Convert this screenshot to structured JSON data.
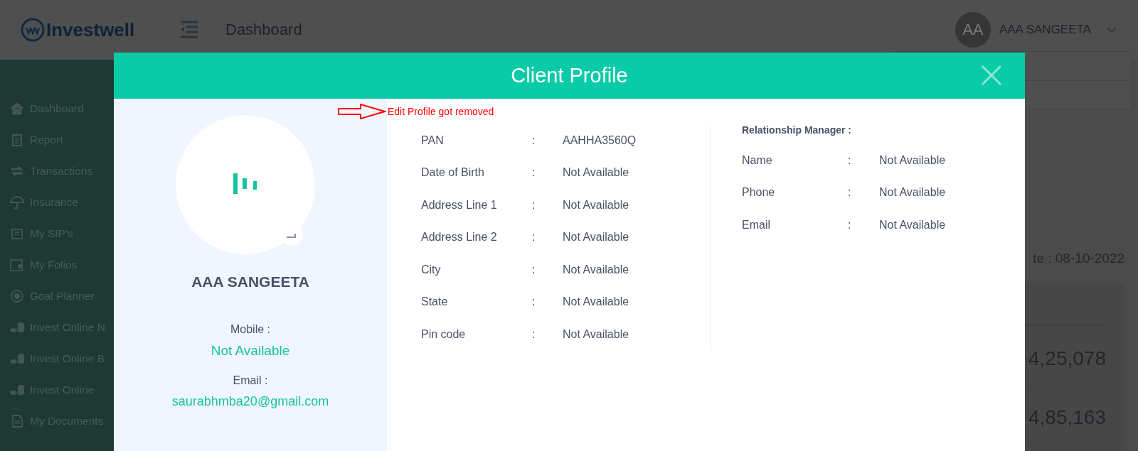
{
  "header": {
    "logo": "Investwell",
    "title": "Dashboard",
    "user": {
      "initials": "AA",
      "name": "AAA SANGEETA"
    }
  },
  "sidebar": {
    "items": [
      {
        "label": "Dashboard"
      },
      {
        "label": "Report"
      },
      {
        "label": "Transactions"
      },
      {
        "label": "Insurance"
      },
      {
        "label": "My SIP's"
      },
      {
        "label": "My Folios"
      },
      {
        "label": "Goal Planner"
      },
      {
        "label": "Invest Online N"
      },
      {
        "label": "Invest Online B"
      },
      {
        "label": "Invest Online"
      },
      {
        "label": "My Documents"
      }
    ]
  },
  "background": {
    "date_text": "te : 08-10-2022",
    "amounts": [
      "4,25,078",
      "4,85,163"
    ]
  },
  "modal": {
    "title": "Client Profile",
    "profile": {
      "name": "AAA SANGEETA",
      "mobile_label": "Mobile :",
      "mobile": "Not Available",
      "email_label": "Email :",
      "email": "saurabhmba20@gmail.com"
    },
    "details": [
      {
        "label": "PAN",
        "separator": ":",
        "value": "AAHHA3560Q"
      },
      {
        "label": "Date of Birth",
        "separator": ":",
        "value": "Not Available"
      },
      {
        "label": "Address Line 1",
        "separator": ":",
        "value": "Not Available"
      },
      {
        "label": "Address Line 2",
        "separator": ":",
        "value": "Not Available"
      },
      {
        "label": "City",
        "separator": ":",
        "value": "Not Available"
      },
      {
        "label": "State",
        "separator": ":",
        "value": "Not Available"
      },
      {
        "label": "Pin code",
        "separator": ":",
        "value": "Not Available"
      }
    ],
    "relationship_manager": {
      "title": "Relationship Manager :",
      "fields": [
        {
          "label": "Name",
          "separator": ":",
          "value": "Not Available"
        },
        {
          "label": "Phone",
          "separator": ":",
          "value": "Not Available"
        },
        {
          "label": "Email",
          "separator": ":",
          "value": "Not Available"
        }
      ]
    }
  },
  "annotation": {
    "text": "Edit Profile got removed"
  }
}
